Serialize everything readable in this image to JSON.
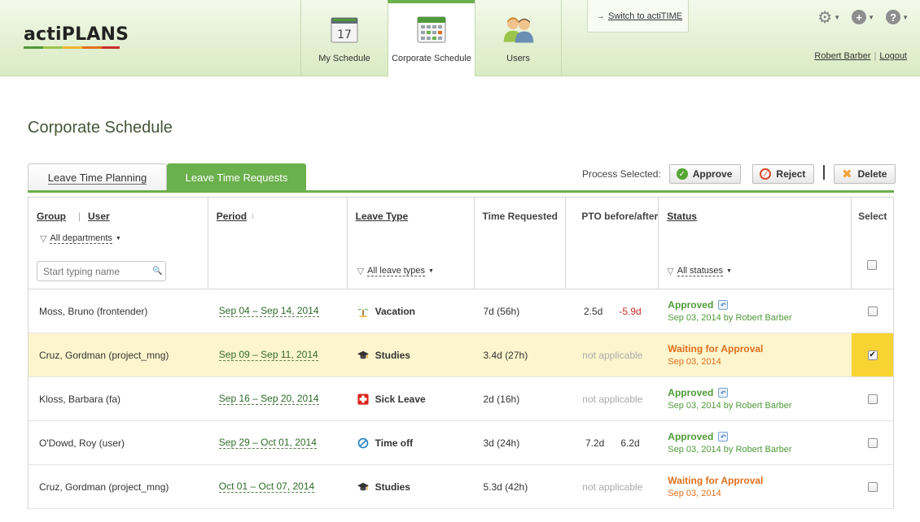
{
  "app": {
    "logo_text": "actiPLANS",
    "logo_bar_colors": [
      "#4f9a38",
      "#9bc54a",
      "#f2b233",
      "#e0701d",
      "#c9302c"
    ]
  },
  "nav": {
    "tabs": [
      {
        "label": "My Schedule",
        "icon": "calendar-day-icon",
        "icon_text": "17"
      },
      {
        "label": "Corporate Schedule",
        "icon": "calendar-grid-icon"
      },
      {
        "label": "Users",
        "icon": "users-icon"
      }
    ],
    "active_tab": "Corporate Schedule"
  },
  "switch": {
    "label": "Switch to actiTIME"
  },
  "top_icons": [
    "gear-icon",
    "plus-icon",
    "help-icon"
  ],
  "user": {
    "name": "Robert Barber",
    "logout": "Logout"
  },
  "page": {
    "title": "Corporate Schedule"
  },
  "subtabs": {
    "planning": "Leave Time Planning",
    "requests": "Leave Time Requests"
  },
  "process": {
    "label": "Process Selected:",
    "approve": "Approve",
    "reject": "Reject",
    "delete": "Delete"
  },
  "table": {
    "headers": {
      "group": "Group",
      "user": "User",
      "period": "Period",
      "leave_type": "Leave Type",
      "time_requested": "Time Requested",
      "pto": "PTO before/after",
      "status": "Status",
      "select": "Select"
    },
    "filters": {
      "departments": "All departments",
      "leave_types": "All leave types",
      "statuses": "All statuses",
      "name_placeholder": "Start typing name"
    },
    "rows": [
      {
        "user": "Moss, Bruno (frontender)",
        "period": "Sep 04 – Sep 14, 2014",
        "leave_type": "Vacation",
        "leave_icon": "palm-tree-icon",
        "time": "7d (56h)",
        "pto_before": "2.5d",
        "pto_after": "-5.9d",
        "pto_na": "",
        "status": "Approved",
        "status_detail": "Sep 03, 2014 by Robert Barber",
        "checked": false
      },
      {
        "user": "Cruz, Gordman (project_mng)",
        "period": "Sep 09 – Sep 11, 2014",
        "leave_type": "Studies",
        "leave_icon": "graduation-cap-icon",
        "time": "3.4d (27h)",
        "pto_before": "",
        "pto_after": "",
        "pto_na": "not applicable",
        "status": "Waiting for Approval",
        "status_detail": "Sep 03, 2014",
        "checked": true
      },
      {
        "user": "Kloss, Barbara (fa)",
        "period": "Sep 16 – Sep 20, 2014",
        "leave_type": "Sick Leave",
        "leave_icon": "medical-cross-icon",
        "time": "2d (16h)",
        "pto_before": "",
        "pto_after": "",
        "pto_na": "not applicable",
        "status": "Approved",
        "status_detail": "Sep 03, 2014 by Robert Barber",
        "checked": false
      },
      {
        "user": "O'Dowd, Roy (user)",
        "period": "Sep 29 – Oct 01, 2014",
        "leave_type": "Time off",
        "leave_icon": "no-entry-icon",
        "time": "3d (24h)",
        "pto_before": "7.2d",
        "pto_after": "6.2d",
        "pto_na": "",
        "status": "Approved",
        "status_detail": "Sep 03, 2014 by Robert Barber",
        "checked": false
      },
      {
        "user": "Cruz, Gordman (project_mng)",
        "period": "Oct 01 – Oct 07, 2014",
        "leave_type": "Studies",
        "leave_icon": "graduation-cap-icon",
        "time": "5.3d (42h)",
        "pto_before": "",
        "pto_after": "",
        "pto_na": "not applicable",
        "status": "Waiting for Approval",
        "status_detail": "Sep 03, 2014",
        "checked": false
      }
    ]
  }
}
